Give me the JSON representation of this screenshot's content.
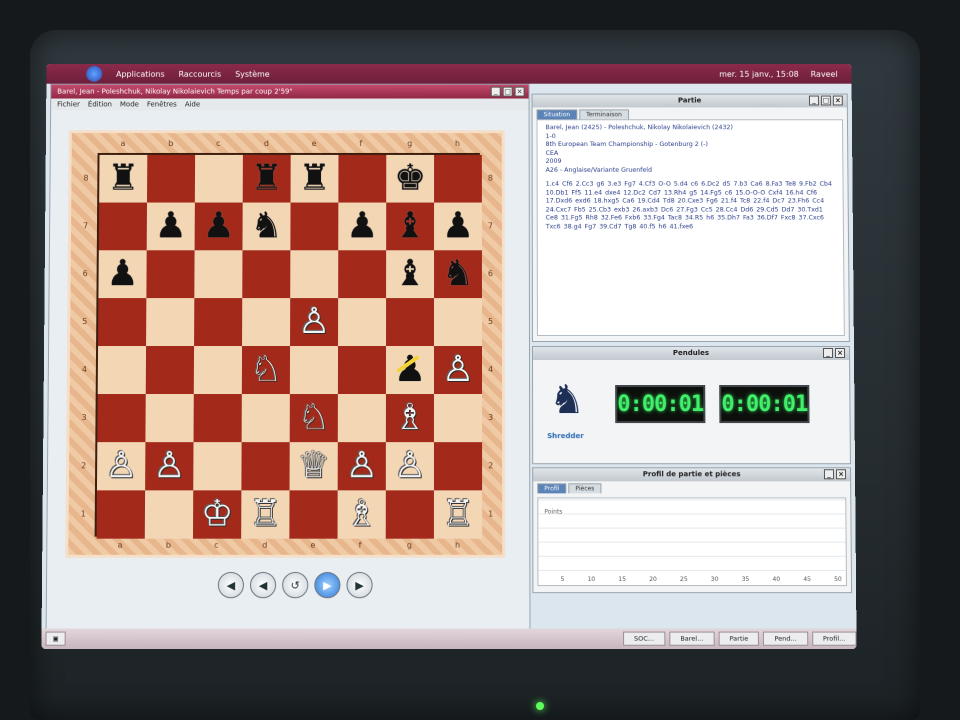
{
  "top_panel": {
    "menus": [
      "Applications",
      "Raccourcis",
      "Système"
    ],
    "right": [
      "mer. 15 janv., 15:08",
      "Raveel"
    ]
  },
  "chess_window": {
    "title": "Barel, Jean - Poleshchuk, Nikolay Nikolaievich   Temps par coup 2'59\"",
    "menu": [
      "Fichier",
      "Édition",
      "Mode",
      "Fenêtres",
      "Aide"
    ]
  },
  "board": {
    "files": [
      "a",
      "b",
      "c",
      "d",
      "e",
      "f",
      "g",
      "h"
    ],
    "ranks": [
      "8",
      "7",
      "6",
      "5",
      "4",
      "3",
      "2",
      "1"
    ],
    "squares": [
      [
        "♜",
        "",
        "",
        "♜",
        "♜",
        "",
        "♚",
        ""
      ],
      [
        "",
        "♟",
        "♟",
        "♞",
        "",
        "♟",
        "♝",
        "♟"
      ],
      [
        "♟",
        "",
        "",
        "",
        "",
        "",
        "♝",
        "♞"
      ],
      [
        "",
        "",
        "",
        "",
        "♙",
        "",
        "",
        ""
      ],
      [
        "",
        "",
        "",
        "♘",
        "",
        "",
        "♟",
        "♙"
      ],
      [
        "",
        "",
        "",
        "",
        "♘",
        "",
        "♗",
        ""
      ],
      [
        "♙",
        "♙",
        "",
        "",
        "♕",
        "♙",
        "♙",
        ""
      ],
      [
        "",
        "",
        "♔",
        "♖",
        "",
        "♗",
        "",
        "♖"
      ]
    ],
    "colors": [
      [
        "b",
        "",
        "",
        "b",
        "b",
        "",
        "b",
        ""
      ],
      [
        "",
        "b",
        "b",
        "b",
        "",
        "b",
        "b",
        "b"
      ],
      [
        "b",
        "",
        "",
        "",
        "",
        "",
        "b",
        "b"
      ],
      [
        "",
        "",
        "",
        "",
        "w",
        "",
        "",
        ""
      ],
      [
        "",
        "",
        "",
        "w",
        "",
        "",
        "b",
        "w"
      ],
      [
        "",
        "",
        "",
        "",
        "w",
        "",
        "w",
        ""
      ],
      [
        "w",
        "w",
        "",
        "",
        "w",
        "w",
        "w",
        ""
      ],
      [
        "",
        "",
        "w",
        "w",
        "",
        "w",
        "",
        "w"
      ]
    ]
  },
  "nav_buttons": [
    {
      "name": "first-move-button",
      "glyph": "◀"
    },
    {
      "name": "prev-move-button",
      "glyph": "◀"
    },
    {
      "name": "undo-button",
      "glyph": "↺"
    },
    {
      "name": "play-button",
      "glyph": "▶"
    },
    {
      "name": "next-move-button",
      "glyph": "▶"
    }
  ],
  "partie": {
    "title": "Partie",
    "tabs": [
      "Situation",
      "Terminaison"
    ],
    "header_lines": [
      "Barel, Jean (2425) - Poleshchuk, Nikolay Nikolaievich (2432)",
      "1-0",
      "8th European Team Championship - Gotenburg 2 (-)",
      "CEA",
      "2009",
      "A26 - Anglaise/Variante Gruenfeld"
    ],
    "moves": "1.c4 Cf6 2.Cc3 g6 3.e3 Fg7 4.Cf3 O-O 5.d4 c6 6.Dc2 d5 7.b3 Ca6 8.Fa3 Te8 9.Fb2 Cb4 10.Db1 Ff5 11.e4 dxe4 12.Dc2 Cd7 13.Rh4 g5 14.Fg5 c6 15.O-O-O Cxf4 16.h4 Cf6 17.Dxd6 exd6 18.hxg5 Ca6 19.Cd4 Td8 20.Cxe3 Fg6 21.f4 Tc8 22.f4 Dc7 23.Fh6 Cc4 24.Cxc7 Fb5 25.Cb3 exb3 26.axb3 Dc6 27.Fg3 Cc5 28.Cc4 Dd6 29.Cd5 Dd7 30.Txd1 Ce8 31.Fg5 Rh8 32.Fe6 Fxb6 33.Fg4 Tac8 34.R5 h6 35.Dh7 Fa3 36.Df7 Fxc8 37.Cxc6 Txc6 38.g4 Fg7 39.Cd7 Tg8 40.f5 h6 41.fxe6"
  },
  "pendules": {
    "title": "Pendules",
    "logo_text": "Shredder",
    "clock_white": "0:00:01",
    "clock_black": "0:00:01"
  },
  "profil": {
    "title": "Profil de partie et pièces",
    "tabs": [
      "Profil",
      "Pièces"
    ],
    "label": "Points",
    "axis": [
      "5",
      "10",
      "15",
      "20",
      "25",
      "30",
      "35",
      "40",
      "45",
      "50"
    ]
  },
  "taskbar": [
    "SOC...",
    "Barel...",
    "Partie",
    "Pend...",
    "Profil..."
  ]
}
